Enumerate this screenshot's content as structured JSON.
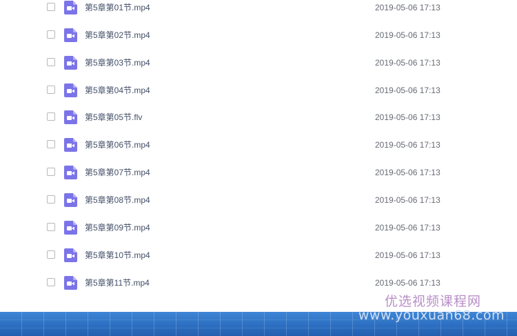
{
  "files": [
    {
      "name": "第5章第01节.mp4",
      "date": "2019-05-06 17:13",
      "icon": "video-file-icon"
    },
    {
      "name": "第5章第02节.mp4",
      "date": "2019-05-06 17:13",
      "icon": "video-file-icon"
    },
    {
      "name": "第5章第03节.mp4",
      "date": "2019-05-06 17:13",
      "icon": "video-file-icon"
    },
    {
      "name": "第5章第04节.mp4",
      "date": "2019-05-06 17:13",
      "icon": "video-file-icon"
    },
    {
      "name": "第5章第05节.flv",
      "date": "2019-05-06 17:13",
      "icon": "video-file-icon"
    },
    {
      "name": "第5章第06节.mp4",
      "date": "2019-05-06 17:13",
      "icon": "video-file-icon"
    },
    {
      "name": "第5章第07节.mp4",
      "date": "2019-05-06 17:13",
      "icon": "video-file-icon"
    },
    {
      "name": "第5章第08节.mp4",
      "date": "2019-05-06 17:13",
      "icon": "video-file-icon"
    },
    {
      "name": "第5章第09节.mp4",
      "date": "2019-05-06 17:13",
      "icon": "video-file-icon"
    },
    {
      "name": "第5章第10节.mp4",
      "date": "2019-05-06 17:13",
      "icon": "video-file-icon"
    },
    {
      "name": "第5章第11节.mp4",
      "date": "2019-05-06 17:13",
      "icon": "video-file-icon"
    }
  ],
  "watermark": {
    "title": "优选视频课程网",
    "url": "www.youxuan68.com"
  },
  "colors": {
    "icon": "#7b74e8",
    "bar": "#2c6fc2",
    "watermark": "#b98ec8"
  }
}
